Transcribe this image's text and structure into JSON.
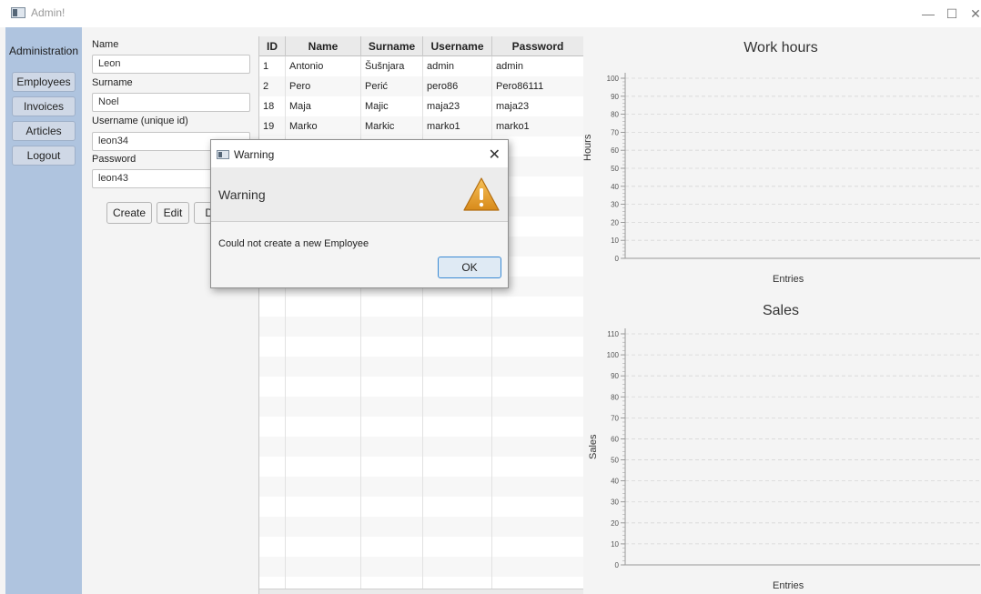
{
  "window": {
    "title": "Admin!",
    "controls": {
      "minimize": "—",
      "maximize": "☐",
      "close": "✕"
    }
  },
  "sidebar": {
    "heading": "Administration",
    "items": [
      {
        "label": "Employees"
      },
      {
        "label": "Invoices"
      },
      {
        "label": "Articles"
      },
      {
        "label": "Logout"
      }
    ]
  },
  "form": {
    "name_label": "Name",
    "name_value": "Leon",
    "surname_label": "Surname",
    "surname_value": "Noel",
    "username_label": "Username (unique id)",
    "username_value": "leon34",
    "password_label": "Password",
    "password_value": "leon43",
    "create_label": "Create",
    "edit_label": "Edit",
    "delete_label": "De"
  },
  "table": {
    "headers": [
      "ID",
      "Name",
      "Surname",
      "Username",
      "Password"
    ],
    "rows": [
      [
        "1",
        "Antonio",
        "Šušnjara",
        "admin",
        "admin"
      ],
      [
        "2",
        "Pero",
        "Perić",
        "pero86",
        "Pero86111"
      ],
      [
        "18",
        "Maja",
        "Majic",
        "maja23",
        "maja23"
      ],
      [
        "19",
        "Marko",
        "Markic",
        "marko1",
        "marko1"
      ]
    ],
    "partial_cell": "a"
  },
  "chart_data": [
    {
      "type": "line",
      "title": "Work hours",
      "xlabel": "Entries",
      "ylabel": "Hours",
      "ylim": [
        0,
        100
      ],
      "yticks": [
        0,
        10,
        20,
        30,
        40,
        50,
        60,
        70,
        80,
        90,
        100
      ],
      "series": [],
      "grid": true
    },
    {
      "type": "line",
      "title": "Sales",
      "xlabel": "Entries",
      "ylabel": "Sales",
      "ylim": [
        0,
        110
      ],
      "yticks": [
        0,
        10,
        20,
        30,
        40,
        50,
        60,
        70,
        80,
        90,
        100,
        110
      ],
      "series": [],
      "grid": true
    }
  ],
  "dialog": {
    "title": "Warning",
    "header": "Warning",
    "message": "Could not create a new Employee",
    "ok_label": "OK",
    "close_glyph": "✕",
    "icon": "warning-triangle-icon"
  }
}
